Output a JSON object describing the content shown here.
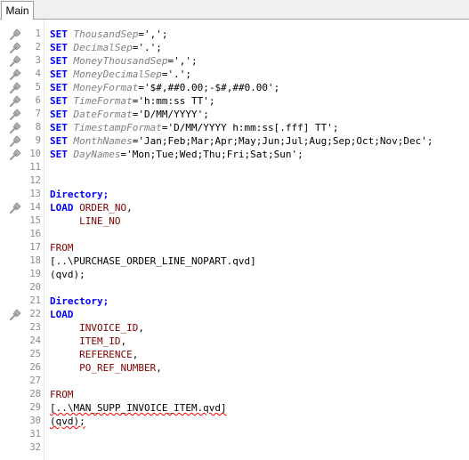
{
  "tabs": [
    {
      "label": "Main"
    }
  ],
  "lines": [
    {
      "n": "1",
      "icon": true,
      "tokens": [
        {
          "t": "SET",
          "c": "kw"
        },
        {
          "t": " ",
          "c": "plain"
        },
        {
          "t": "ThousandSep",
          "c": "var"
        },
        {
          "t": "=','",
          "c": "plain"
        },
        {
          "t": ";",
          "c": "plain"
        }
      ]
    },
    {
      "n": "2",
      "icon": true,
      "tokens": [
        {
          "t": "SET",
          "c": "kw"
        },
        {
          "t": " ",
          "c": "plain"
        },
        {
          "t": "DecimalSep",
          "c": "var"
        },
        {
          "t": "='.';",
          "c": "plain"
        }
      ]
    },
    {
      "n": "3",
      "icon": true,
      "tokens": [
        {
          "t": "SET",
          "c": "kw"
        },
        {
          "t": " ",
          "c": "plain"
        },
        {
          "t": "MoneyThousandSep",
          "c": "var"
        },
        {
          "t": "=',';",
          "c": "plain"
        }
      ]
    },
    {
      "n": "4",
      "icon": true,
      "tokens": [
        {
          "t": "SET",
          "c": "kw"
        },
        {
          "t": " ",
          "c": "plain"
        },
        {
          "t": "MoneyDecimalSep",
          "c": "var"
        },
        {
          "t": "='.';",
          "c": "plain"
        }
      ]
    },
    {
      "n": "5",
      "icon": true,
      "tokens": [
        {
          "t": "SET",
          "c": "kw"
        },
        {
          "t": " ",
          "c": "plain"
        },
        {
          "t": "MoneyFormat",
          "c": "var"
        },
        {
          "t": "='$#,##0.00;-$#,##0.00';",
          "c": "plain"
        }
      ]
    },
    {
      "n": "6",
      "icon": true,
      "tokens": [
        {
          "t": "SET",
          "c": "kw"
        },
        {
          "t": " ",
          "c": "plain"
        },
        {
          "t": "TimeFormat",
          "c": "var"
        },
        {
          "t": "='h:mm:ss TT';",
          "c": "plain"
        }
      ]
    },
    {
      "n": "7",
      "icon": true,
      "tokens": [
        {
          "t": "SET",
          "c": "kw"
        },
        {
          "t": " ",
          "c": "plain"
        },
        {
          "t": "DateFormat",
          "c": "var"
        },
        {
          "t": "='D/MM/YYYY';",
          "c": "plain"
        }
      ]
    },
    {
      "n": "8",
      "icon": true,
      "tokens": [
        {
          "t": "SET",
          "c": "kw"
        },
        {
          "t": " ",
          "c": "plain"
        },
        {
          "t": "TimestampFormat",
          "c": "var"
        },
        {
          "t": "='D/MM/YYYY h:mm:ss[.fff] TT';",
          "c": "plain"
        }
      ]
    },
    {
      "n": "9",
      "icon": true,
      "tokens": [
        {
          "t": "SET",
          "c": "kw"
        },
        {
          "t": " ",
          "c": "plain"
        },
        {
          "t": "MonthNames",
          "c": "var"
        },
        {
          "t": "='Jan;Feb;Mar;Apr;May;Jun;Jul;Aug;Sep;Oct;Nov;Dec';",
          "c": "plain"
        }
      ]
    },
    {
      "n": "10",
      "icon": true,
      "tokens": [
        {
          "t": "SET",
          "c": "kw"
        },
        {
          "t": " ",
          "c": "plain"
        },
        {
          "t": "DayNames",
          "c": "var"
        },
        {
          "t": "='Mon;Tue;Wed;Thu;Fri;Sat;Sun';",
          "c": "plain"
        }
      ]
    },
    {
      "n": "11",
      "icon": false,
      "tokens": []
    },
    {
      "n": "12",
      "icon": false,
      "tokens": []
    },
    {
      "n": "13",
      "icon": false,
      "tokens": [
        {
          "t": "Directory;",
          "c": "kw"
        }
      ]
    },
    {
      "n": "14",
      "icon": true,
      "tokens": [
        {
          "t": "LOAD",
          "c": "kw"
        },
        {
          "t": " ",
          "c": "plain"
        },
        {
          "t": "ORDER_NO",
          "c": "fld"
        },
        {
          "t": ",",
          "c": "plain"
        }
      ]
    },
    {
      "n": "15",
      "icon": false,
      "tokens": [
        {
          "t": "     ",
          "c": "plain"
        },
        {
          "t": "LINE_NO",
          "c": "fld"
        }
      ]
    },
    {
      "n": "16",
      "icon": false,
      "tokens": []
    },
    {
      "n": "17",
      "icon": false,
      "tokens": [
        {
          "t": "FROM",
          "c": "fld"
        }
      ]
    },
    {
      "n": "18",
      "icon": false,
      "tokens": [
        {
          "t": "[..\\PURCHASE_ORDER_LINE_NOPART.qvd]",
          "c": "plain"
        }
      ]
    },
    {
      "n": "19",
      "icon": false,
      "tokens": [
        {
          "t": "(qvd);",
          "c": "plain"
        }
      ]
    },
    {
      "n": "20",
      "icon": false,
      "tokens": []
    },
    {
      "n": "21",
      "icon": false,
      "tokens": [
        {
          "t": "Directory;",
          "c": "kw"
        }
      ]
    },
    {
      "n": "22",
      "icon": true,
      "tokens": [
        {
          "t": "LOAD",
          "c": "kw"
        }
      ]
    },
    {
      "n": "23",
      "icon": false,
      "tokens": [
        {
          "t": "     ",
          "c": "plain"
        },
        {
          "t": "INVOICE_ID",
          "c": "fld"
        },
        {
          "t": ",",
          "c": "plain"
        }
      ]
    },
    {
      "n": "24",
      "icon": false,
      "tokens": [
        {
          "t": "     ",
          "c": "plain"
        },
        {
          "t": "ITEM_ID",
          "c": "fld"
        },
        {
          "t": ",",
          "c": "plain"
        }
      ]
    },
    {
      "n": "25",
      "icon": false,
      "tokens": [
        {
          "t": "     ",
          "c": "plain"
        },
        {
          "t": "REFERENCE",
          "c": "fld"
        },
        {
          "t": ",",
          "c": "plain"
        }
      ]
    },
    {
      "n": "26",
      "icon": false,
      "tokens": [
        {
          "t": "     ",
          "c": "plain"
        },
        {
          "t": "PO_REF_NUMBER",
          "c": "fld"
        },
        {
          "t": ",",
          "c": "plain"
        }
      ]
    },
    {
      "n": "27",
      "icon": false,
      "tokens": []
    },
    {
      "n": "28",
      "icon": false,
      "tokens": [
        {
          "t": "FROM",
          "c": "fld"
        }
      ]
    },
    {
      "n": "29",
      "icon": false,
      "tokens": [
        {
          "t": "[..\\MAN_SUPP_INVOICE_ITEM.qvd]",
          "c": "plain err"
        }
      ]
    },
    {
      "n": "30",
      "icon": false,
      "tokens": [
        {
          "t": "(qvd);",
          "c": "plain err"
        }
      ]
    },
    {
      "n": "31",
      "icon": false,
      "tokens": []
    },
    {
      "n": "32",
      "icon": false,
      "tokens": []
    }
  ]
}
